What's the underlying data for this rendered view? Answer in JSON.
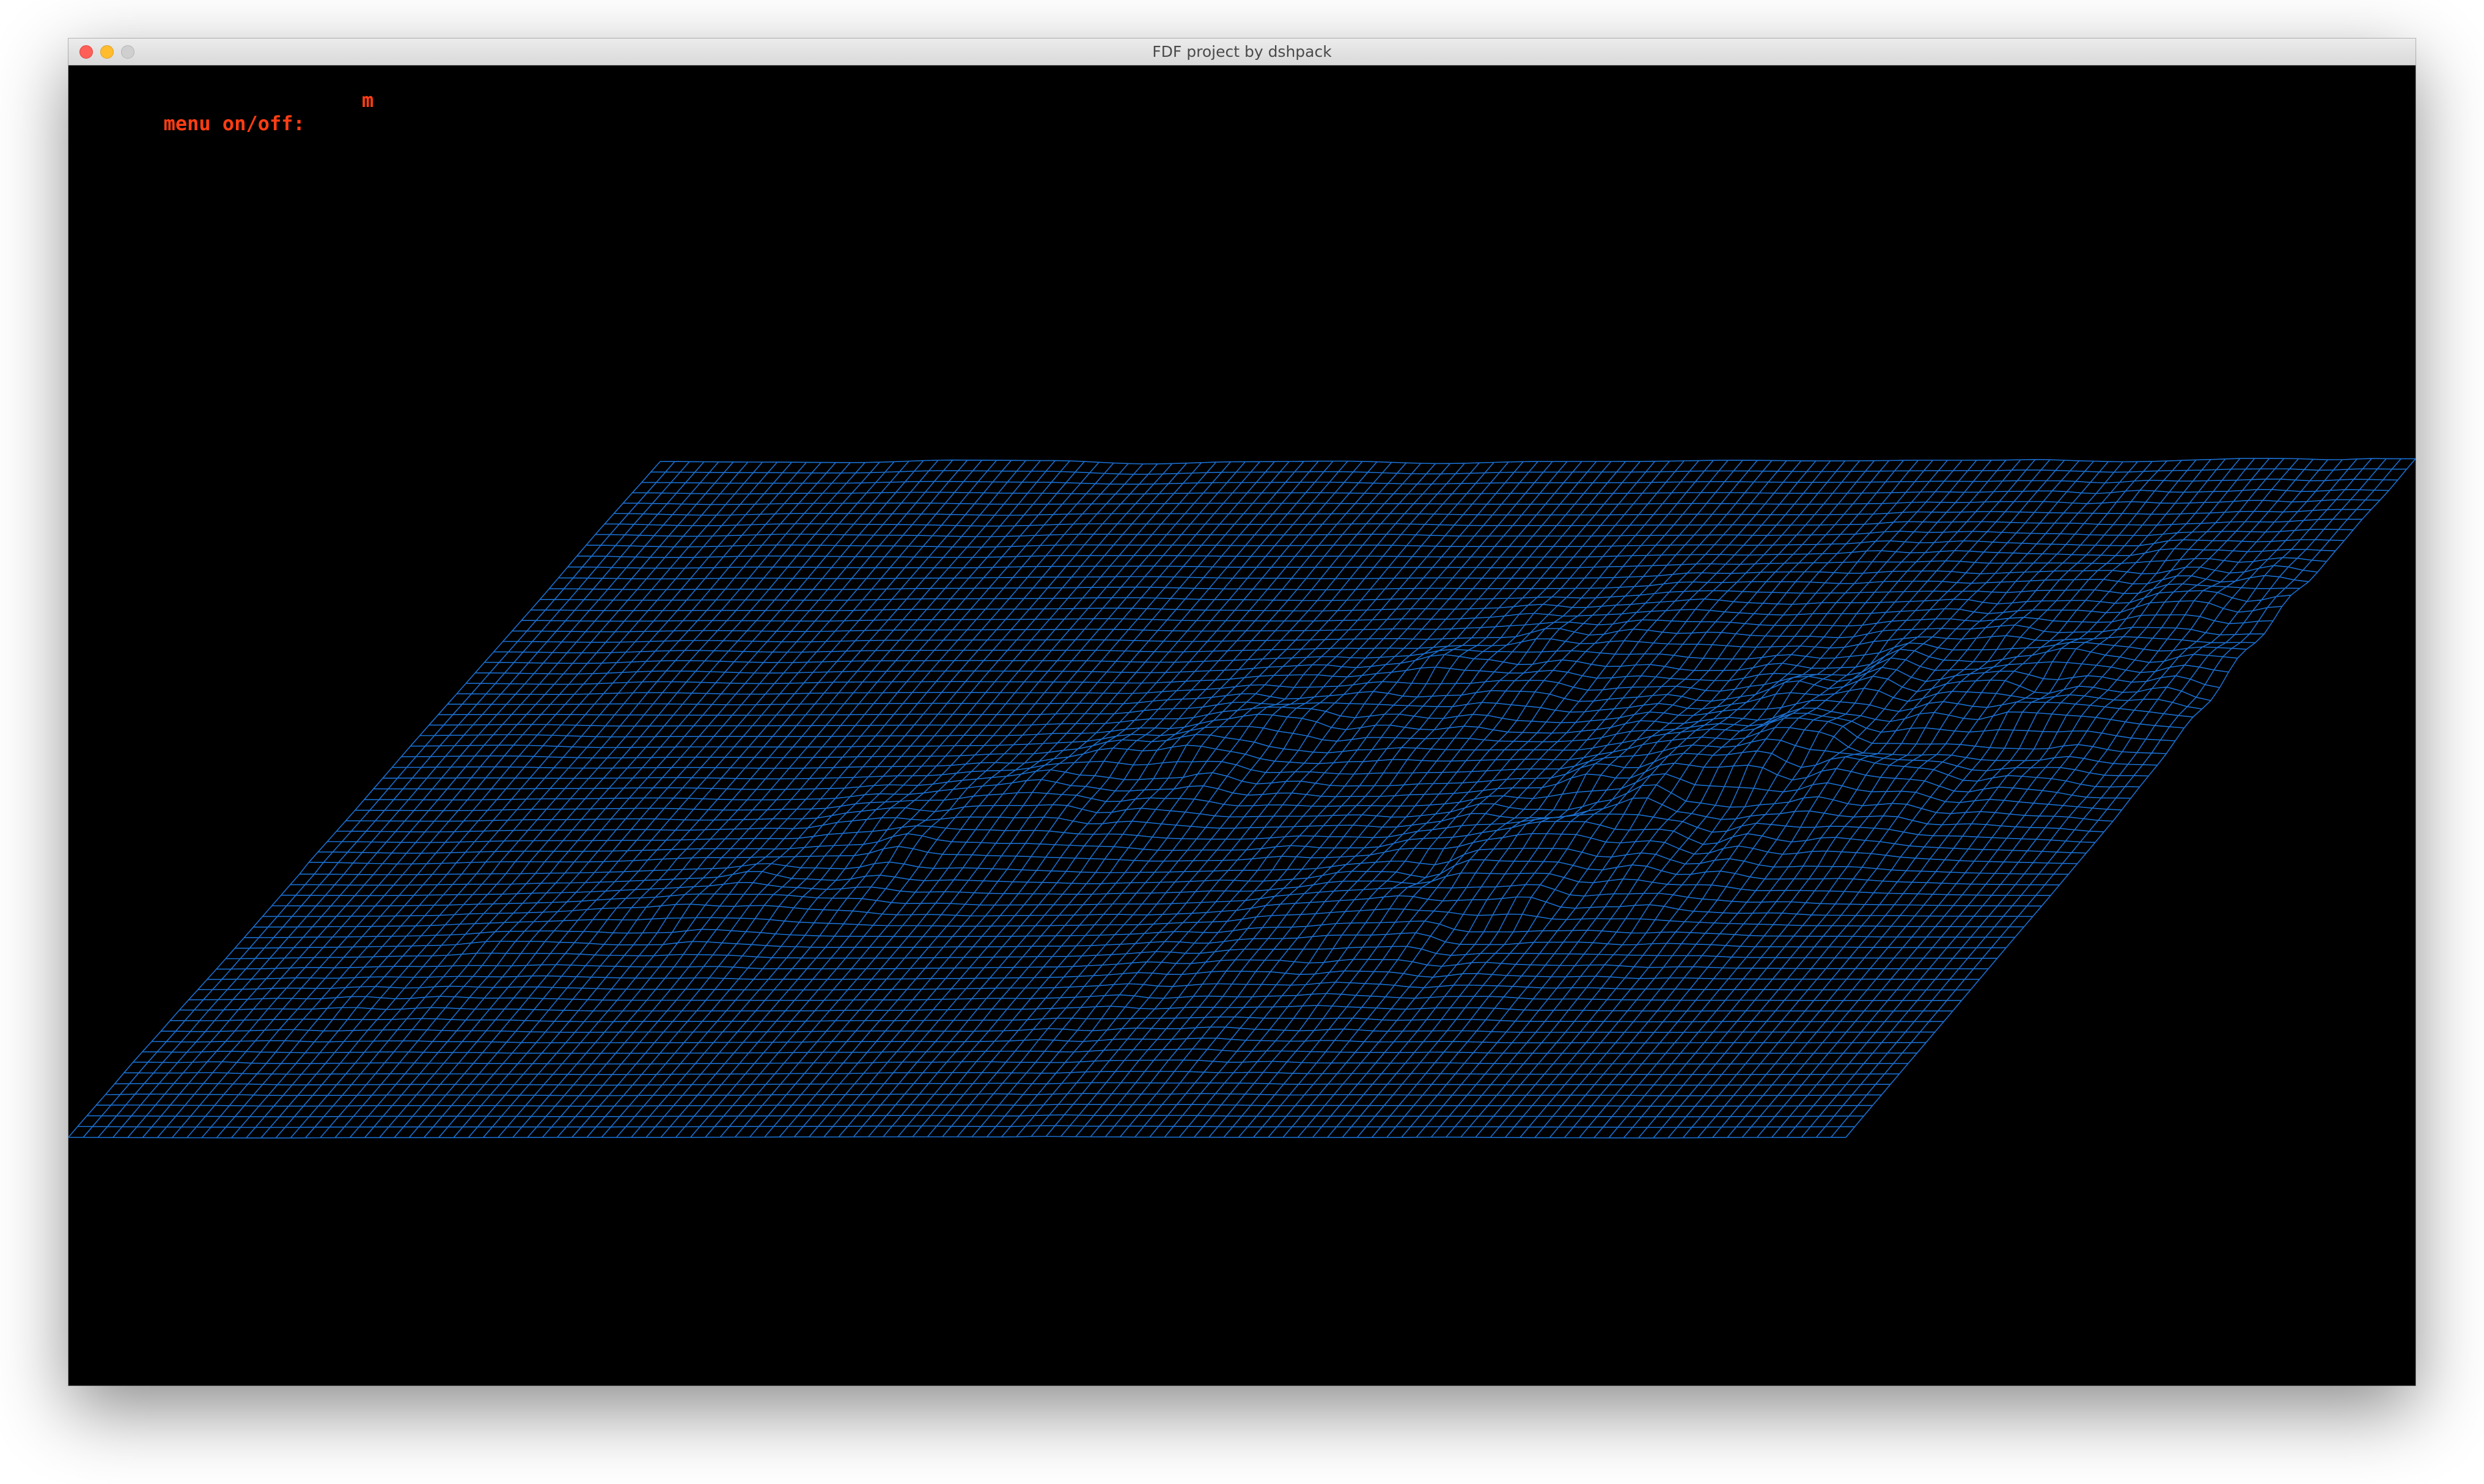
{
  "window": {
    "title": "FDF project by dshpack",
    "controls": [
      "close-icon",
      "minimize-icon",
      "zoom-icon"
    ]
  },
  "menu_hint": {
    "label": "menu on/off:",
    "key": "m",
    "color": "#ff3d14"
  },
  "wireframe": {
    "line_color": "#1a6fd0",
    "background": "#000000",
    "projection": "parallel"
  }
}
